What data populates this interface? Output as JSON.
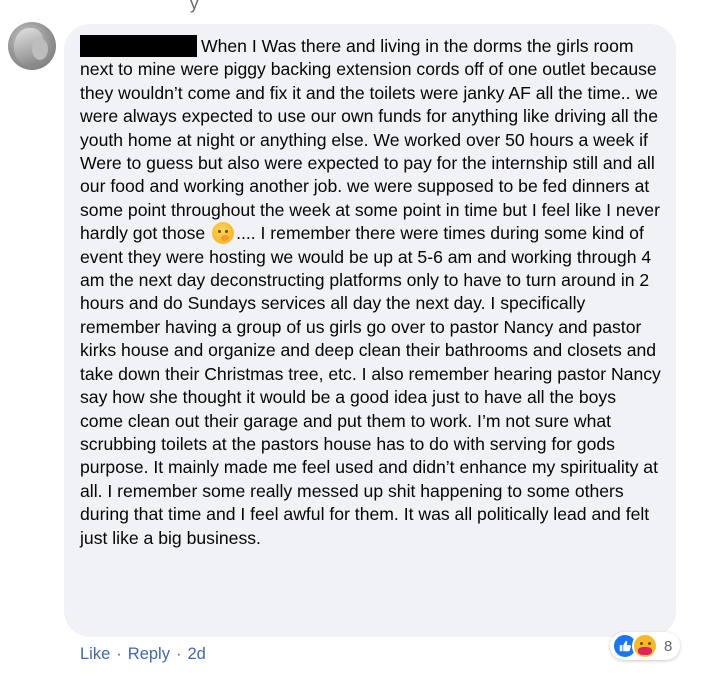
{
  "top_fragment": "y",
  "comment": {
    "segments": [
      "When I Was there and living in the dorms the girls room next to mine were piggy backing extension cords off of one outlet because they wouldn’t come and fix it and the toilets were janky AF all the time.. we were always expected to use our own funds for anything like driving all the youth home at night or anything else. We worked over 50 hours a week if Were to guess but also were expected to pay for the internship still and all our food and working another job. we were supposed to be fed dinners at some point throughout the week at some point in time but I feel like I never hardly got those",
      ".... I remember there were times during some kind of event they were hosting we would be up at 5-6 am and working through 4 am the next day deconstructing platforms only to have to turn around in 2 hours and do Sundays services all day the next day. I specifically remember having a group of us girls go over to pastor Nancy and pastor kirks house and organize and deep clean their bathrooms and closets and take down their Christmas tree, etc. I also remember hearing pastor Nancy say how she thought it would be a good idea just to have all the boys come clean out their garage and put them to work. I’m not sure what scrubbing toilets at the pastors house has to do with serving for gods purpose. It mainly made me feel used and didn’t enhance my spirituality at all. I remember some really messed up shit happening to some others during that time and I feel awful for them. It was all politically lead and felt just like a big business."
    ],
    "inline_emoji": "thinking-face-emoji"
  },
  "reactions": {
    "types": [
      "like-icon",
      "care-icon"
    ],
    "count": "8"
  },
  "actions": {
    "like_label": "Like",
    "reply_label": "Reply",
    "separator": "·",
    "timestamp": "2d"
  },
  "colors": {
    "bubble_bg": "#f0f2f5",
    "link_blue": "#4267b2",
    "like_blue": "#1877f2",
    "muted_text": "#65676b"
  }
}
